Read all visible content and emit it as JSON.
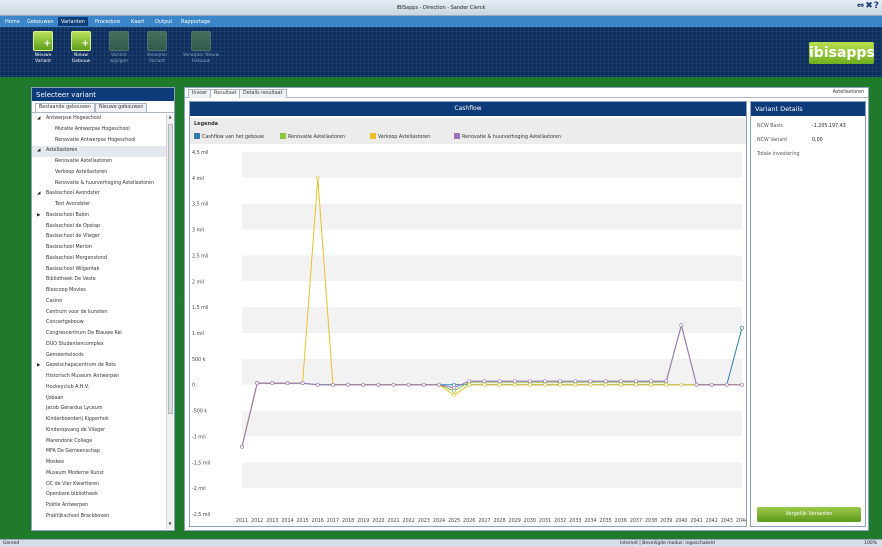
{
  "window": {
    "title": "IBISapps - Direction - Sander Clerck",
    "controls": "⇔✖?"
  },
  "menu": {
    "items": [
      "Home",
      "Gebouwen",
      "Varianten",
      "Procedure",
      "Kaart",
      "Output",
      "Rapportage"
    ],
    "active": "Varianten"
  },
  "ribbon": {
    "buttons": [
      {
        "label1": "Nieuwe",
        "label2": "Variant",
        "enabled": true
      },
      {
        "label1": "Nieuw",
        "label2": "Gebouw",
        "enabled": true
      },
      {
        "label1": "Variant",
        "label2": "wijzigen",
        "enabled": false
      },
      {
        "label1": "Verwijder",
        "label2": "Variant",
        "enabled": false
      },
      {
        "label1": "Verwijder Nieuw",
        "label2": "Gebouw",
        "enabled": false
      }
    ]
  },
  "logo": {
    "text1": "ibis",
    "text2": "apps"
  },
  "sidebar": {
    "title": "Selecteer variant",
    "tabs": [
      "Bestaande gebouwen",
      "Nieuwe gebouwen"
    ],
    "tree": [
      {
        "label": "Antwerpse Hogeschool",
        "level": 0,
        "expander": "◢"
      },
      {
        "label": "Mutatie Antwerpse Hogeschool",
        "level": 1
      },
      {
        "label": "Renovatie Antwerpse Hogeschool",
        "level": 1
      },
      {
        "label": "Astellastoren",
        "level": 0,
        "expander": "◢",
        "selected": true
      },
      {
        "label": "Renovatie Astellastoren",
        "level": 1
      },
      {
        "label": "Verkoop Astellastoren",
        "level": 1
      },
      {
        "label": "Renovatie & huurverhoging Astellastoren",
        "level": 1
      },
      {
        "label": "Basisschool Avondster",
        "level": 0,
        "expander": "◢"
      },
      {
        "label": "Test Avondster",
        "level": 1
      },
      {
        "label": "Basisschool Balon",
        "level": 0,
        "expander": "▶"
      },
      {
        "label": "Basisschool de Opstap",
        "level": 0
      },
      {
        "label": "Basisschool de Vlieger",
        "level": 0
      },
      {
        "label": "Basisschool Merlon",
        "level": 0
      },
      {
        "label": "Basisschool Morgenstond",
        "level": 0
      },
      {
        "label": "Basisschool Wilgentak",
        "level": 0
      },
      {
        "label": "Bibliotheek De Veste",
        "level": 0
      },
      {
        "label": "Bioscoop Movies",
        "level": 0
      },
      {
        "label": "Casino",
        "level": 0
      },
      {
        "label": "Centrum voor de kunsten",
        "level": 0
      },
      {
        "label": "Concertgebouw",
        "level": 0
      },
      {
        "label": "Congrescentrum De Blauwe Kei",
        "level": 0
      },
      {
        "label": "DUO Studentencomplex",
        "level": 0
      },
      {
        "label": "Gemeentelocds",
        "level": 0
      },
      {
        "label": "Gezelschapscentrum de Rots",
        "level": 0,
        "expander": "▶"
      },
      {
        "label": "Historisch Museum Antwerpen",
        "level": 0
      },
      {
        "label": "Hockeyclub A.H.V.",
        "level": 0
      },
      {
        "label": "IJsbaan",
        "level": 0
      },
      {
        "label": "Jacob Gerardus Lyceum",
        "level": 0
      },
      {
        "label": "Kinderboerderij Kipperhok",
        "level": 0
      },
      {
        "label": "Kinderopvang de Vlieger",
        "level": 0
      },
      {
        "label": "Marendonk College",
        "level": 0
      },
      {
        "label": "MFA De Gemeenschap",
        "level": 0
      },
      {
        "label": "Moskee",
        "level": 0
      },
      {
        "label": "Museum Moderne Kunst",
        "level": 0
      },
      {
        "label": "OC de Vier Kwartieren",
        "level": 0
      },
      {
        "label": "Openbare bibliotheek",
        "level": 0
      },
      {
        "label": "Politie Antwerpen",
        "level": 0
      },
      {
        "label": "Praktijkschool Brackboven",
        "level": 0
      }
    ]
  },
  "main": {
    "tabs": [
      "Invoer",
      "Resultaat",
      "Details resultaat"
    ],
    "active_tab": "Resultaat",
    "breadcrumb": "Astellastoren"
  },
  "chart_data": {
    "type": "line",
    "title": "Cashflow",
    "legend_title": "Legenda",
    "ylim": [
      -2500000,
      4500000
    ],
    "yticks": [
      {
        "v": 4500000,
        "label": "4,5 mil"
      },
      {
        "v": 4000000,
        "label": "4 mil"
      },
      {
        "v": 3500000,
        "label": "3,5 mil"
      },
      {
        "v": 3000000,
        "label": "3 mil"
      },
      {
        "v": 2500000,
        "label": "2,5 mil"
      },
      {
        "v": 2000000,
        "label": "2 mil"
      },
      {
        "v": 1500000,
        "label": "1,5 mil"
      },
      {
        "v": 1000000,
        "label": "1 mil"
      },
      {
        "v": 500000,
        "label": "500 k"
      },
      {
        "v": 0,
        "label": "0"
      },
      {
        "v": -500000,
        "label": "-500 k"
      },
      {
        "v": -1000000,
        "label": "-1 mil"
      },
      {
        "v": -1500000,
        "label": "-1,5 mil"
      },
      {
        "v": -2000000,
        "label": "-2 mil"
      },
      {
        "v": -2500000,
        "label": "-2,5 mil"
      }
    ],
    "x": [
      2011,
      2012,
      2013,
      2014,
      2015,
      2016,
      2017,
      2018,
      2019,
      2020,
      2021,
      2022,
      2023,
      2024,
      2025,
      2026,
      2027,
      2028,
      2029,
      2030,
      2031,
      2032,
      2033,
      2034,
      2035,
      2036,
      2037,
      2038,
      2039,
      2040,
      2041,
      2042,
      2043,
      2044
    ],
    "series": [
      {
        "name": "Cashflow van het gebouw",
        "color": "#2b7fb0",
        "values": [
          -1200000,
          30000,
          30000,
          30000,
          30000,
          0,
          0,
          0,
          0,
          0,
          0,
          0,
          0,
          0,
          0,
          0,
          0,
          0,
          0,
          0,
          0,
          0,
          0,
          0,
          0,
          0,
          0,
          0,
          0,
          0,
          0,
          0,
          0,
          1100000
        ]
      },
      {
        "name": "Renovatie Astellastoren",
        "color": "#8dc63f",
        "values": [
          -1200000,
          30000,
          30000,
          30000,
          30000,
          0,
          0,
          0,
          0,
          0,
          0,
          0,
          0,
          0,
          -120000,
          50000,
          50000,
          50000,
          50000,
          50000,
          50000,
          50000,
          50000,
          50000,
          50000,
          50000,
          50000,
          50000,
          50000,
          1150000,
          0,
          0,
          0,
          0
        ]
      },
      {
        "name": "Verkoop Astellastoren",
        "color": "#e8c229",
        "values": [
          -1200000,
          30000,
          30000,
          30000,
          30000,
          4000000,
          0,
          0,
          0,
          0,
          0,
          0,
          0,
          0,
          -200000,
          0,
          0,
          0,
          0,
          0,
          0,
          0,
          0,
          0,
          0,
          0,
          0,
          0,
          0,
          0,
          0,
          0,
          0,
          0
        ]
      },
      {
        "name": "Renovatie & huurverhoging Astellastoren",
        "color": "#9b72c4",
        "values": [
          -1200000,
          30000,
          30000,
          30000,
          30000,
          0,
          0,
          0,
          0,
          0,
          0,
          0,
          0,
          0,
          -60000,
          70000,
          70000,
          70000,
          70000,
          70000,
          70000,
          70000,
          70000,
          70000,
          70000,
          70000,
          70000,
          70000,
          70000,
          1150000,
          0,
          0,
          0,
          0
        ]
      }
    ]
  },
  "details": {
    "title": "Variant Details",
    "rows": [
      {
        "label": "NCW Basis",
        "value": "-1.205.197,43"
      },
      {
        "label": "NCW Variant",
        "value": "0,00"
      },
      {
        "label": "Totale investering",
        "value": ""
      }
    ],
    "compare_button": "Vergelijk Varianten"
  },
  "status": {
    "left": "Gereed",
    "middle": "Internet | Beveiligde modus: ingeschakeld",
    "zoom": "100%"
  }
}
